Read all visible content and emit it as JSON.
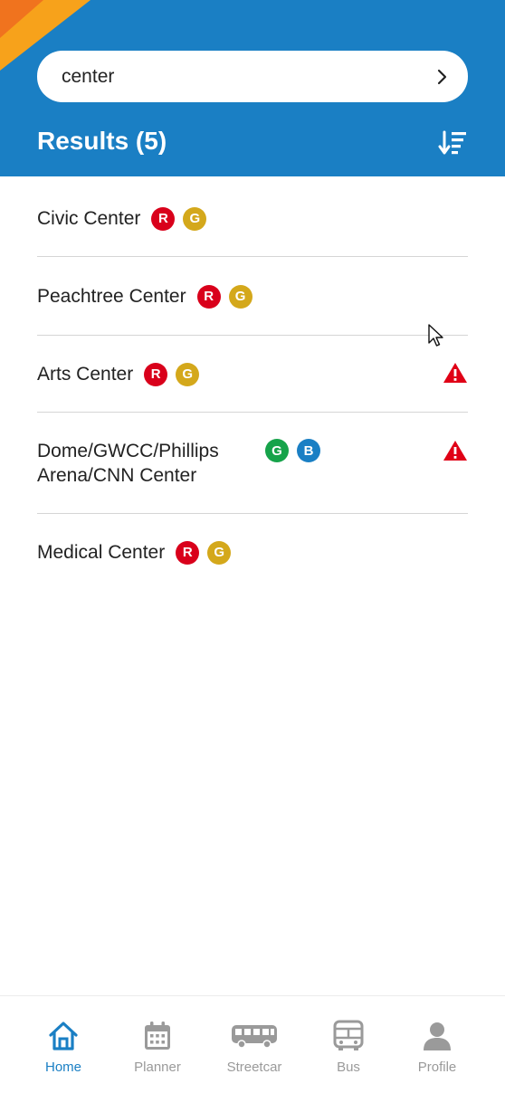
{
  "colors": {
    "header_bg": "#1a7fc4",
    "red_line": "#d9001b",
    "gold_line": "#d4a81b",
    "green_line": "#16a34a",
    "blue_line": "#1a7fc4",
    "alert": "#e00016",
    "tab_active": "#1a7fc4",
    "tab_inactive": "#9a9a9a"
  },
  "search": {
    "value": "center",
    "submit_icon": "chevron-right-icon"
  },
  "results": {
    "title": "Results (5)",
    "sort_icon": "sort-icon"
  },
  "stations": [
    {
      "name": "Civic Center",
      "lines": [
        "R",
        "G"
      ],
      "alert": false
    },
    {
      "name": "Peachtree Center",
      "lines": [
        "R",
        "G"
      ],
      "alert": false
    },
    {
      "name": "Arts Center",
      "lines": [
        "R",
        "G"
      ],
      "alert": true
    },
    {
      "name_line1": "Dome/GWCC/Phillips",
      "name_line2": "Arena/CNN Center",
      "lines": [
        "G",
        "B"
      ],
      "alert": true
    },
    {
      "name": "Medical Center",
      "lines": [
        "R",
        "G"
      ],
      "alert": false
    }
  ],
  "tabs": [
    {
      "label": "Home",
      "icon": "home-icon",
      "active": true
    },
    {
      "label": "Planner",
      "icon": "calendar-icon",
      "active": false
    },
    {
      "label": "Streetcar",
      "icon": "streetcar-icon",
      "active": false
    },
    {
      "label": "Bus",
      "icon": "bus-icon",
      "active": false
    },
    {
      "label": "Profile",
      "icon": "person-icon",
      "active": false
    }
  ]
}
